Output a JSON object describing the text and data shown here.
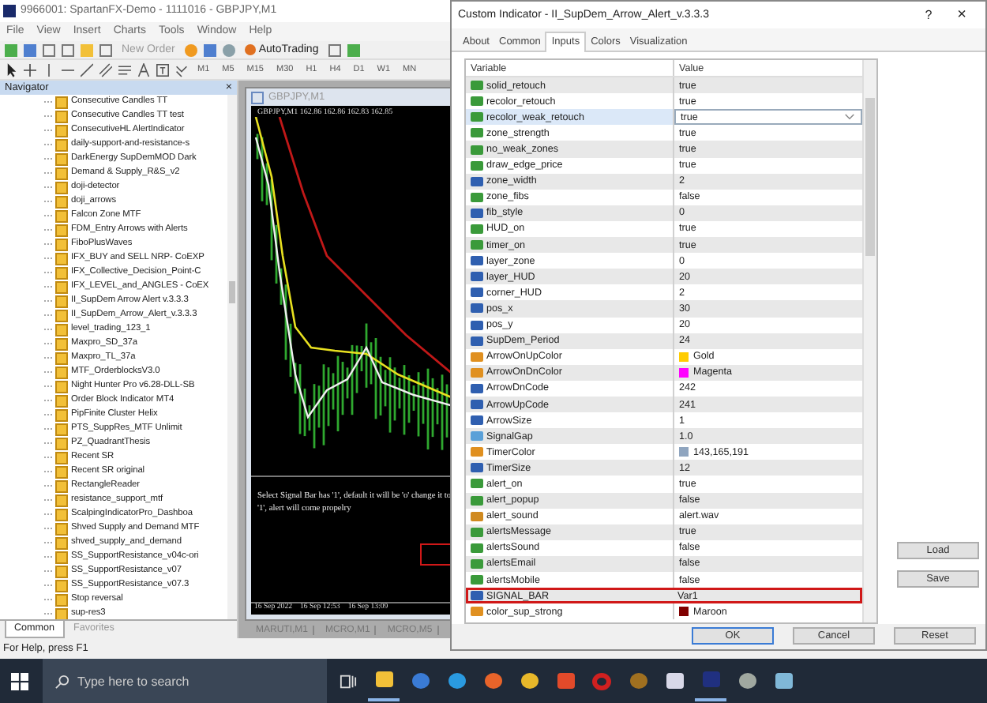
{
  "window": {
    "title": "9966001: SpartanFX-Demo - 1111016 - GBPJPY,M1"
  },
  "menu": [
    "File",
    "View",
    "Insert",
    "Charts",
    "Tools",
    "Window",
    "Help"
  ],
  "toolbar": {
    "new_order": "New Order",
    "autotrading": "AutoTrading",
    "timeframes": [
      "M1",
      "M5",
      "M15",
      "M30",
      "H1",
      "H4",
      "D1",
      "W1",
      "MN"
    ]
  },
  "navigator": {
    "title": "Navigator",
    "close": "×",
    "items": [
      "Consecutive Candles TT",
      "Consecutive Candles TT test",
      "ConsecutiveHL AlertIndicator",
      "daily-support-and-resistance-s",
      "DarkEnergy SupDemMOD Dark",
      "Demand & Supply_R&S_v2",
      "doji-detector",
      "doji_arrows",
      "Falcon Zone MTF",
      "FDM_Entry Arrows with Alerts",
      "FiboPlusWaves",
      "IFX_BUY and SELL NRP- CoEXP",
      "IFX_Collective_Decision_Point-C",
      "IFX_LEVEL_and_ANGLES - CoEX",
      "II_SupDem Arrow Alert v.3.3.3",
      "II_SupDem_Arrow_Alert_v.3.3.3",
      "level_trading_123_1",
      "Maxpro_SD_37a",
      "Maxpro_TL_37a",
      "MTF_OrderblocksV3.0",
      "Night Hunter Pro v6.28-DLL-SB",
      "Order Block Indicator MT4",
      "PipFinite Cluster Helix",
      "PTS_SuppRes_MTF Unlimit",
      "PZ_QuadrantThesis",
      "Recent SR",
      "Recent SR original",
      "RectangleReader",
      "resistance_support_mtf",
      "ScalpingIndicatorPro_Dashboa",
      "Shved Supply and Demand MTF",
      "shved_supply_and_demand",
      "SS_SupportResistance_v04c-ori",
      "SS_SupportResistance_v07",
      "SS_SupportResistance_v07.3",
      "Stop reversal",
      "sup-res3"
    ],
    "tabs": [
      {
        "label": "Common",
        "selected": true
      },
      {
        "label": "Favorites",
        "selected": false
      }
    ]
  },
  "chart": {
    "title": "GBPJPY,M1",
    "header": "GBPJPY,M1  162.86  162.86  162.83  162.85",
    "comment": "Select Signal Bar has '1', default it will be 'o' change it to '1', alert will come propelry",
    "times": [
      "16 Sep 2022",
      "16 Sep 12:53",
      "16 Sep 13:09"
    ],
    "tabs": [
      {
        "label": "MARUTI,M1",
        "selected": false
      },
      {
        "label": "MCRO,M1",
        "selected": false
      },
      {
        "label": "MCRO,M5",
        "selected": false
      }
    ]
  },
  "status_bar": "For Help, press F1",
  "taskbar": {
    "search_placeholder": "Type here to search"
  },
  "dialog": {
    "title": "Custom Indicator - II_SupDem_Arrow_Alert_v.3.3.3",
    "help": "?",
    "close": "×",
    "tabs": [
      {
        "label": "About",
        "selected": false
      },
      {
        "label": "Common",
        "selected": false
      },
      {
        "label": "Inputs",
        "selected": true
      },
      {
        "label": "Colors",
        "selected": false
      },
      {
        "label": "Visualization",
        "selected": false
      }
    ],
    "columns": [
      "Variable",
      "Value"
    ],
    "rows": [
      {
        "kind": "bool",
        "variable": "solid_retouch",
        "value": "true",
        "selected": false,
        "highlighted": false
      },
      {
        "kind": "bool",
        "variable": "recolor_retouch",
        "value": "true",
        "selected": false,
        "highlighted": false
      },
      {
        "kind": "bool",
        "variable": "recolor_weak_retouch",
        "value": "true",
        "selected": true,
        "highlighted": false
      },
      {
        "kind": "bool",
        "variable": "zone_strength",
        "value": "true",
        "selected": false,
        "highlighted": false
      },
      {
        "kind": "bool",
        "variable": "no_weak_zones",
        "value": "true",
        "selected": false,
        "highlighted": false
      },
      {
        "kind": "bool",
        "variable": "draw_edge_price",
        "value": "true",
        "selected": false,
        "highlighted": false
      },
      {
        "kind": "int",
        "variable": "zone_width",
        "value": "2",
        "selected": false,
        "highlighted": false
      },
      {
        "kind": "bool",
        "variable": "zone_fibs",
        "value": "false",
        "selected": false,
        "highlighted": false
      },
      {
        "kind": "int",
        "variable": "fib_style",
        "value": "0",
        "selected": false,
        "highlighted": false
      },
      {
        "kind": "bool",
        "variable": "HUD_on",
        "value": "true",
        "selected": false,
        "highlighted": false
      },
      {
        "kind": "bool",
        "variable": "timer_on",
        "value": "true",
        "selected": false,
        "highlighted": false
      },
      {
        "kind": "int",
        "variable": "layer_zone",
        "value": "0",
        "selected": false,
        "highlighted": false
      },
      {
        "kind": "int",
        "variable": "layer_HUD",
        "value": "20",
        "selected": false,
        "highlighted": false
      },
      {
        "kind": "int",
        "variable": "corner_HUD",
        "value": "2",
        "selected": false,
        "highlighted": false
      },
      {
        "kind": "int",
        "variable": "pos_x",
        "value": "30",
        "selected": false,
        "highlighted": false
      },
      {
        "kind": "int",
        "variable": "pos_y",
        "value": "20",
        "selected": false,
        "highlighted": false
      },
      {
        "kind": "int",
        "variable": "SupDem_Period",
        "value": "24",
        "selected": false,
        "highlighted": false
      },
      {
        "kind": "color",
        "variable": "ArrowOnUpColor",
        "value": "Gold",
        "color": "#ffcc00",
        "selected": false,
        "highlighted": false
      },
      {
        "kind": "color",
        "variable": "ArrowOnDnColor",
        "value": "Magenta",
        "color": "#ff00ff",
        "selected": false,
        "highlighted": false
      },
      {
        "kind": "int",
        "variable": "ArrowDnCode",
        "value": "242",
        "selected": false,
        "highlighted": false
      },
      {
        "kind": "int",
        "variable": "ArrowUpCode",
        "value": "241",
        "selected": false,
        "highlighted": false
      },
      {
        "kind": "int",
        "variable": "ArrowSize",
        "value": "1",
        "selected": false,
        "highlighted": false
      },
      {
        "kind": "double",
        "variable": "SignalGap",
        "value": "1.0",
        "selected": false,
        "highlighted": false
      },
      {
        "kind": "color",
        "variable": "TimerColor",
        "value": "143,165,191",
        "color": "#8fa5bf",
        "selected": false,
        "highlighted": false
      },
      {
        "kind": "int",
        "variable": "TimerSize",
        "value": "12",
        "selected": false,
        "highlighted": false
      },
      {
        "kind": "bool",
        "variable": "alert_on",
        "value": "true",
        "selected": false,
        "highlighted": false
      },
      {
        "kind": "bool",
        "variable": "alert_popup",
        "value": "false",
        "selected": false,
        "highlighted": false
      },
      {
        "kind": "string",
        "variable": "alert_sound",
        "value": "alert.wav",
        "selected": false,
        "highlighted": false
      },
      {
        "kind": "bool",
        "variable": "alertsMessage",
        "value": "true",
        "selected": false,
        "highlighted": false
      },
      {
        "kind": "bool",
        "variable": "alertsSound",
        "value": "false",
        "selected": false,
        "highlighted": false
      },
      {
        "kind": "bool",
        "variable": "alertsEmail",
        "value": "false",
        "selected": false,
        "highlighted": false
      },
      {
        "kind": "bool",
        "variable": "alertsMobile",
        "value": "false",
        "selected": false,
        "highlighted": false
      },
      {
        "kind": "int",
        "variable": "SIGNAL_BAR",
        "value": "Var1",
        "selected": false,
        "highlighted": true
      },
      {
        "kind": "color",
        "variable": "color_sup_strong",
        "value": "Maroon",
        "color": "#800000",
        "selected": false,
        "highlighted": false
      }
    ],
    "side_buttons": [
      "Load",
      "Save"
    ],
    "buttons": [
      "OK",
      "Cancel",
      "Reset"
    ]
  }
}
